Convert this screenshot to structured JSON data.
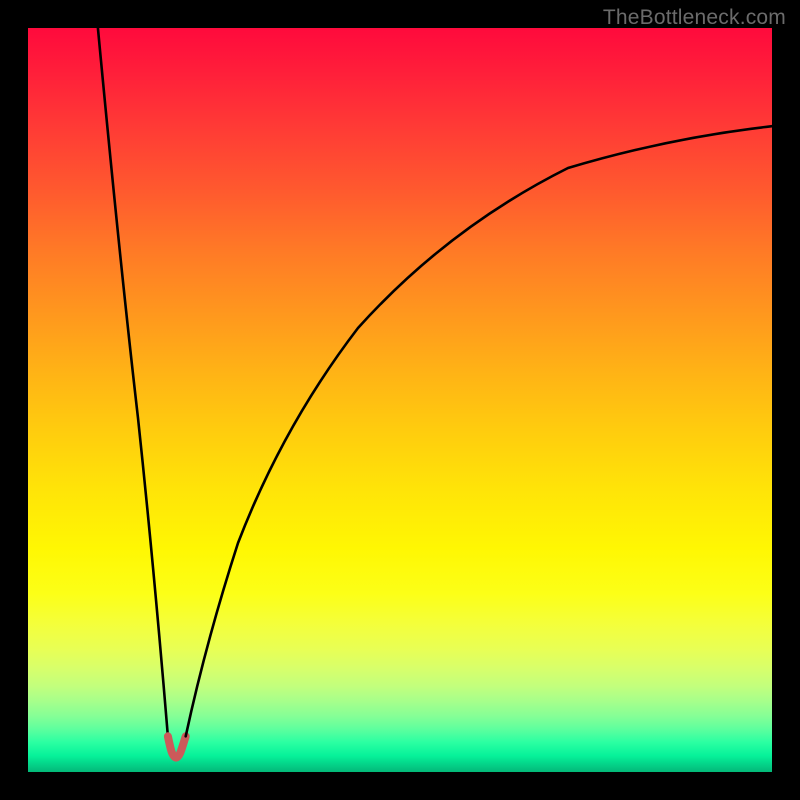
{
  "watermark": {
    "text": "TheBottleneck.com"
  },
  "chart_data": {
    "type": "line",
    "title": "",
    "xlabel": "",
    "ylabel": "",
    "xlim": [
      0,
      100
    ],
    "ylim": [
      0,
      100
    ],
    "grid": false,
    "series": [
      {
        "name": "left-branch-black",
        "color": "#000000",
        "x": [
          9.4,
          10.0,
          11.0,
          12.0,
          13.0,
          14.0,
          15.0,
          16.0,
          17.0,
          18.0,
          18.8
        ],
        "y": [
          100.0,
          88.0,
          76.0,
          64.0,
          52.0,
          41.0,
          31.0,
          22.0,
          14.5,
          8.5,
          4.8
        ]
      },
      {
        "name": "right-branch-black",
        "color": "#000000",
        "x": [
          21.2,
          22.0,
          23.0,
          25.0,
          28.0,
          32.0,
          37.0,
          43.0,
          50.0,
          58.0,
          67.0,
          77.0,
          88.0,
          100.0
        ],
        "y": [
          4.8,
          8.5,
          13.0,
          21.5,
          31.0,
          41.0,
          50.5,
          59.0,
          66.5,
          72.5,
          77.5,
          81.3,
          84.3,
          86.8
        ]
      },
      {
        "name": "trough-red",
        "color": "#cc5a5a",
        "x": [
          18.8,
          19.1,
          19.5,
          19.9,
          20.1,
          20.5,
          20.9,
          21.2
        ],
        "y": [
          4.8,
          3.2,
          2.2,
          2.0,
          2.0,
          2.2,
          3.2,
          4.8
        ]
      }
    ],
    "annotations": []
  }
}
